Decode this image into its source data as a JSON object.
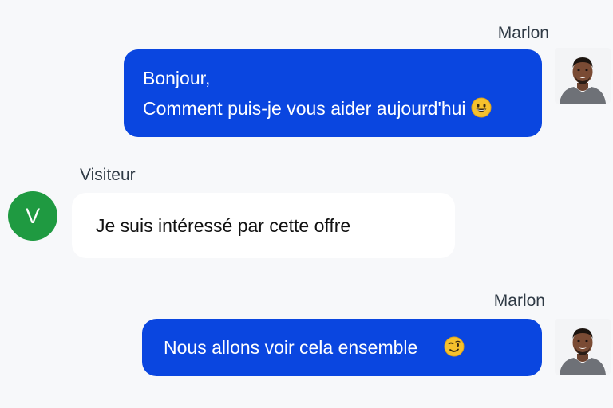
{
  "messages": [
    {
      "sender": "Marlon",
      "lines": [
        "Bonjour,",
        "Comment puis-je vous aider aujourd'hui"
      ],
      "emoji": "smiling-face-emoji"
    },
    {
      "sender": "Visiteur",
      "avatar_initial": "V",
      "text": "Je suis intéressé par cette offre"
    },
    {
      "sender": "Marlon",
      "text": "Nous allons voir cela ensemble",
      "emoji": "winking-face-emoji"
    }
  ],
  "colors": {
    "outgoing_bubble": "#0a46e0",
    "incoming_bubble": "#ffffff",
    "visitor_avatar": "#1f9a41",
    "background": "#f7f8fa"
  }
}
